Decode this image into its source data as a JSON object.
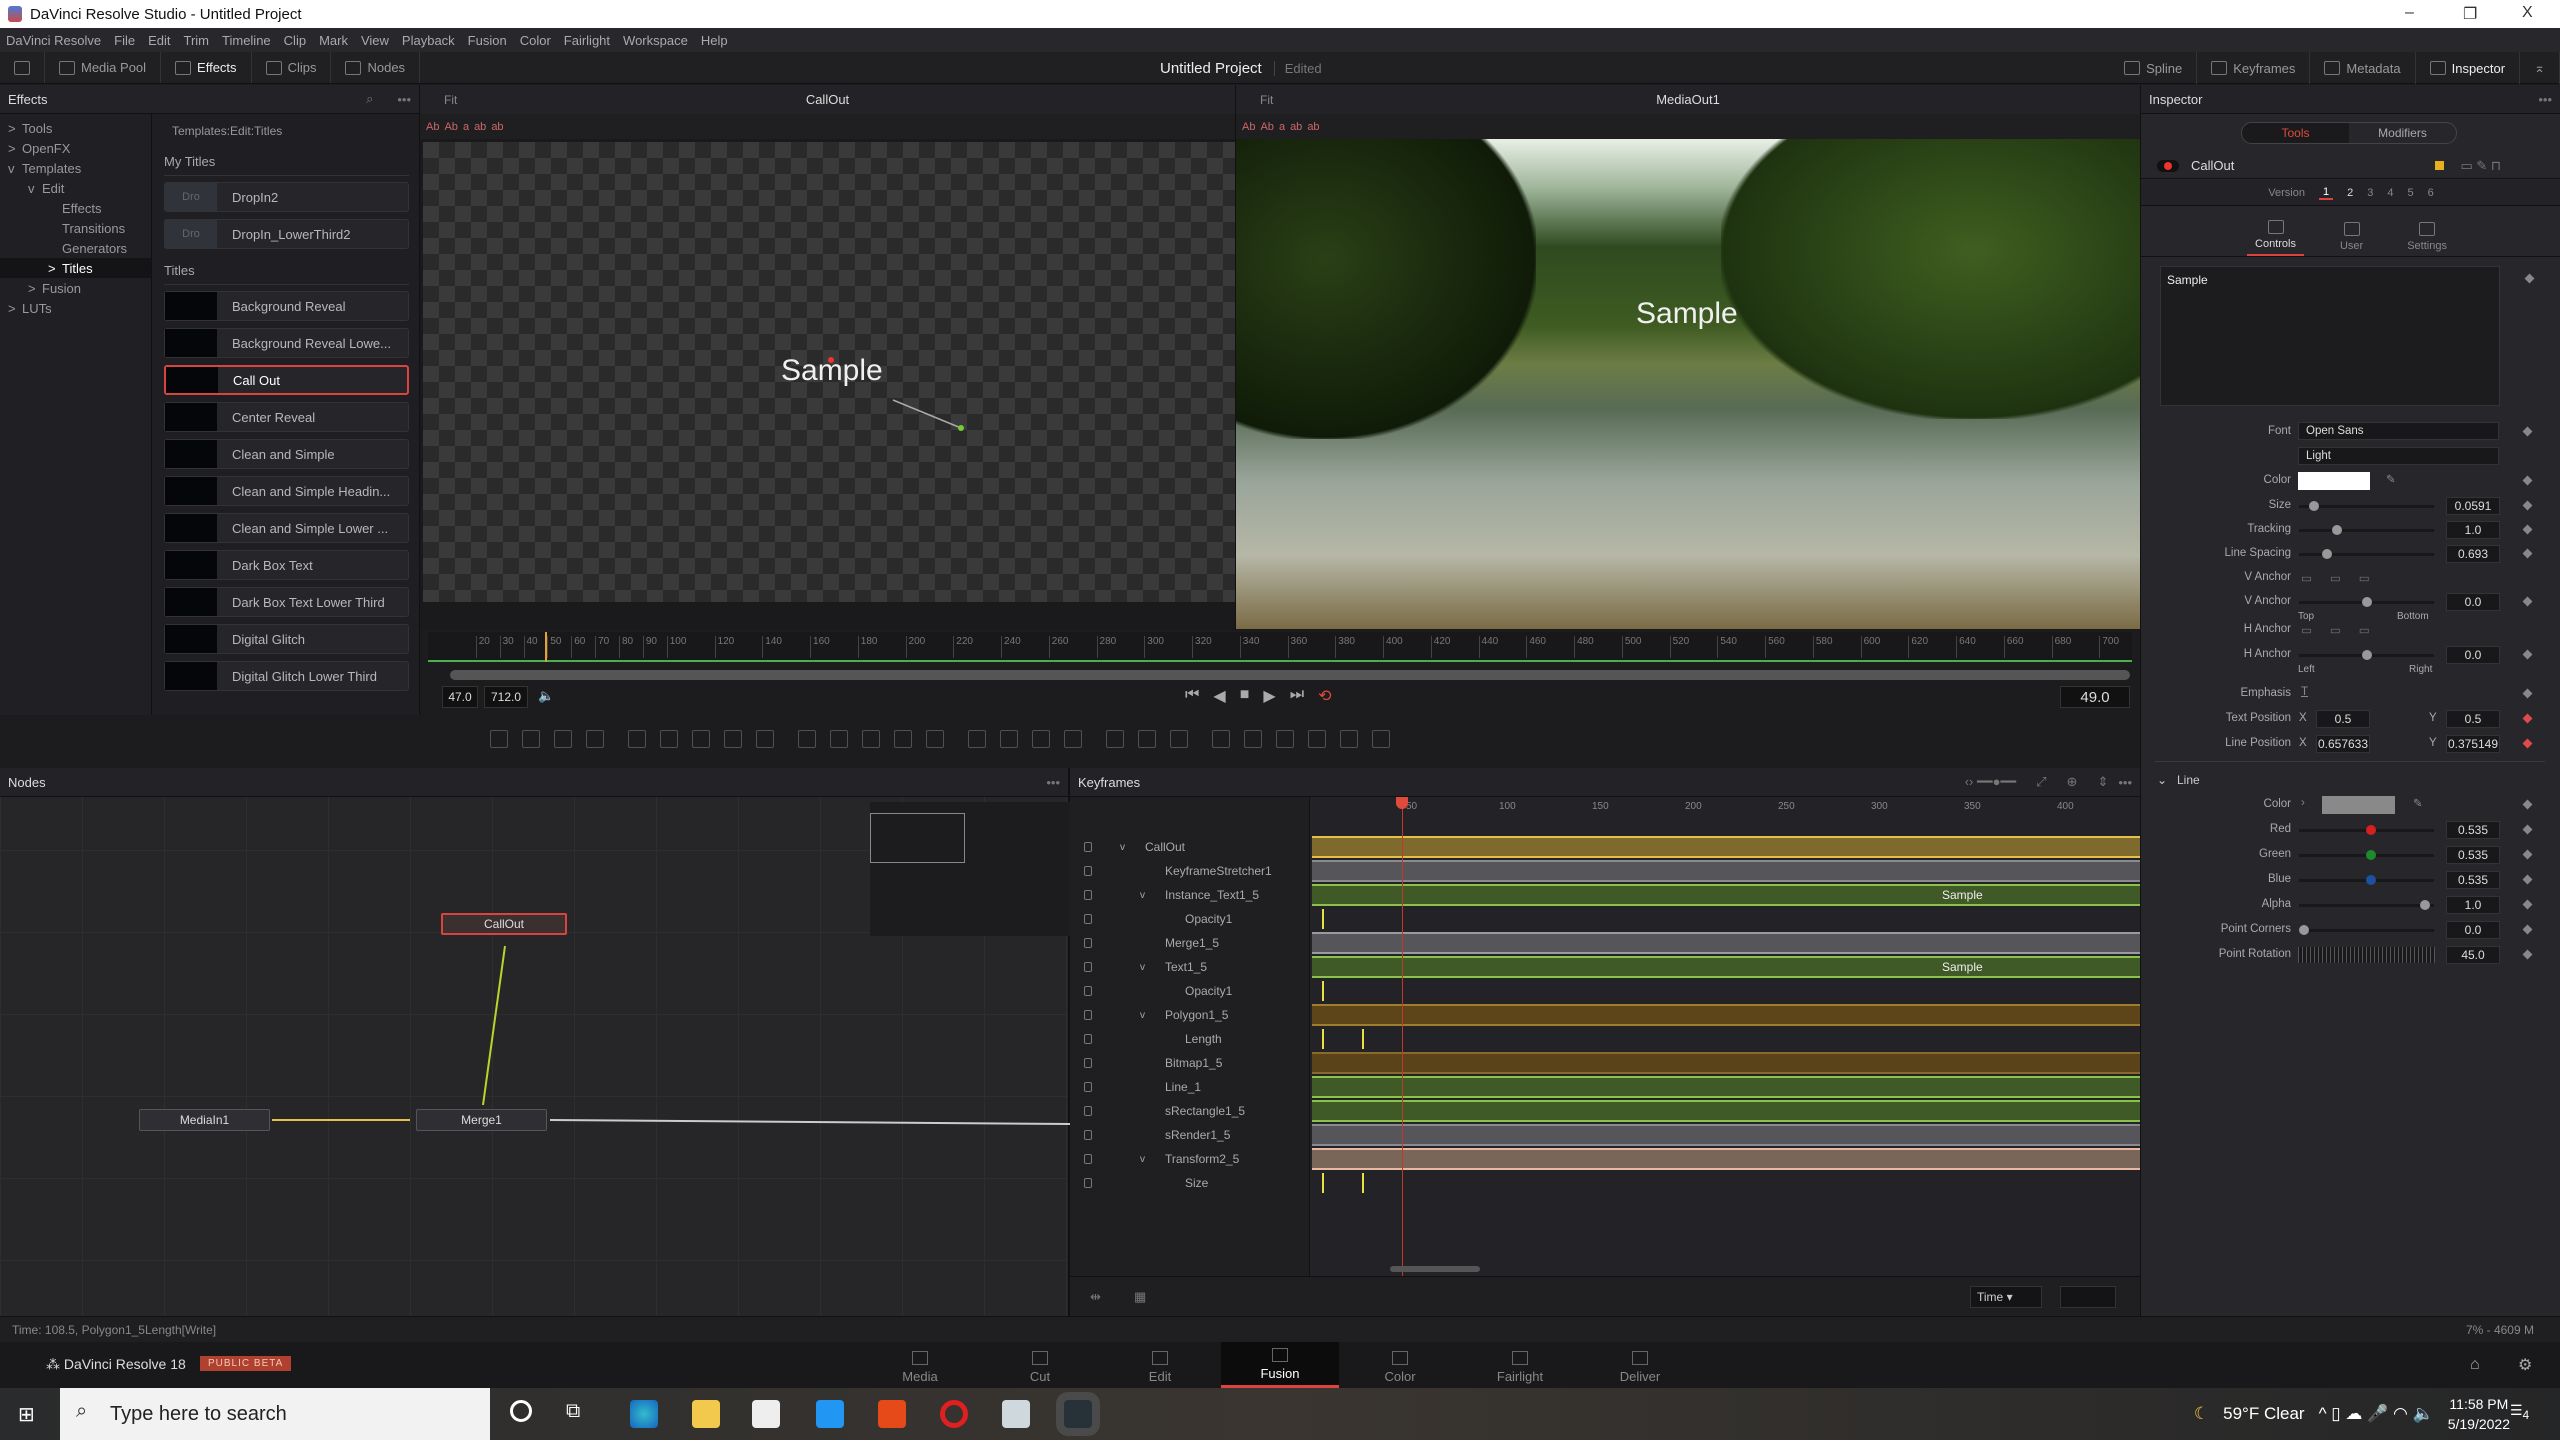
{
  "window": {
    "title": "DaVinci Resolve Studio - Untitled Project",
    "minimize": "–",
    "restore": "❐",
    "close": "X"
  },
  "menu": [
    "DaVinci Resolve",
    "File",
    "Edit",
    "Trim",
    "Timeline",
    "Clip",
    "Mark",
    "View",
    "Playback",
    "Fusion",
    "Color",
    "Fairlight",
    "Workspace",
    "Help"
  ],
  "toolbar": {
    "left": [
      {
        "label": "Media Pool",
        "icon": "media-pool-icon"
      },
      {
        "label": "Effects",
        "icon": "effects-wand-icon",
        "active": true
      },
      {
        "label": "Clips",
        "icon": "clips-icon"
      },
      {
        "label": "Nodes",
        "icon": "nodes-icon"
      }
    ],
    "project": "Untitled Project",
    "edited": "Edited",
    "right": [
      {
        "label": "Spline",
        "icon": "spline-icon"
      },
      {
        "label": "Keyframes",
        "icon": "keyframes-icon"
      },
      {
        "label": "Metadata",
        "icon": "metadata-icon"
      },
      {
        "label": "Inspector",
        "icon": "inspector-icon",
        "active": true
      }
    ]
  },
  "effects": {
    "title": "Effects",
    "tree": [
      {
        "label": "Tools",
        "lvl": 0,
        "arrow": ">"
      },
      {
        "label": "OpenFX",
        "lvl": 0,
        "arrow": ">"
      },
      {
        "label": "Templates",
        "lvl": 0,
        "arrow": "v"
      },
      {
        "label": "Edit",
        "lvl": 1,
        "arrow": "v"
      },
      {
        "label": "Effects",
        "lvl": 2,
        "arrow": ""
      },
      {
        "label": "Transitions",
        "lvl": 2,
        "arrow": ""
      },
      {
        "label": "Generators",
        "lvl": 2,
        "arrow": ""
      },
      {
        "label": "Titles",
        "lvl": 2,
        "arrow": ">",
        "selected": true
      },
      {
        "label": "Fusion",
        "lvl": 1,
        "arrow": ">"
      },
      {
        "label": "LUTs",
        "lvl": 0,
        "arrow": ">"
      }
    ],
    "breadcrumb": "Templates:Edit:Titles",
    "my_titles_header": "My Titles",
    "my_titles": [
      {
        "thumb": "Dro",
        "label": "DropIn2"
      },
      {
        "thumb": "Dro",
        "label": "DropIn_LowerThird2"
      }
    ],
    "titles_header": "Titles",
    "titles": [
      "Background Reveal",
      "Background Reveal Lowe...",
      "Call Out",
      "Center Reveal",
      "Clean and Simple",
      "Clean and Simple Headin...",
      "Clean and Simple Lower ...",
      "Dark Box Text",
      "Dark Box Text Lower Third",
      "Digital Glitch",
      "Digital Glitch Lower Third"
    ],
    "selected_title": "Call Out"
  },
  "viewer_left": {
    "fit": "Fit",
    "title": "CallOut",
    "overlay_text": "Sample"
  },
  "viewer_right": {
    "fit": "Fit",
    "title": "MediaOut1",
    "overlay_text": "Sample"
  },
  "timeline": {
    "ticks": [
      20,
      30,
      40,
      50,
      60,
      70,
      80,
      90,
      100,
      120,
      140,
      160,
      180,
      200,
      220,
      240,
      260,
      280,
      300,
      320,
      340,
      360,
      380,
      400,
      420,
      440,
      460,
      480,
      500,
      520,
      540,
      560,
      580,
      600,
      620,
      640,
      660,
      680,
      700
    ],
    "range": [
      0,
      712
    ],
    "start": "47.0",
    "end": "712.0",
    "current": "49.0",
    "current_frame": 49
  },
  "transport": {
    "first": "⏮",
    "prev": "◀",
    "stop": "■",
    "play": "▶",
    "last": "⏭",
    "loop": "⟲"
  },
  "tools_bar": [
    "background-icon",
    "paint-icon",
    "text-icon",
    "brush-icon",
    "particles-icon",
    "color-corrector-icon",
    "curves-icon",
    "brightness-icon",
    "blur-icon",
    "merge-icon",
    "matte-icon",
    "mediain-icon",
    "resize-icon",
    "transform-icon",
    "rectangle-icon",
    "ellipse-icon",
    "polygon-icon",
    "bspline-icon",
    "tracker-icon",
    "planar-tracker-icon",
    "camera-tracker-icon",
    "shape3d-icon",
    "image-plane-icon",
    "text3d-icon",
    "merge3d-icon",
    "renderer3d-icon",
    "camera3d-icon"
  ],
  "nodes": {
    "title": "Nodes",
    "items": [
      {
        "id": "callout",
        "label": "CallOut"
      },
      {
        "id": "mediain",
        "label": "MediaIn1"
      },
      {
        "id": "merge",
        "label": "Merge1"
      }
    ]
  },
  "keyframes": {
    "title": "Keyframes",
    "ruler": [
      50,
      100,
      150,
      200,
      250,
      300,
      350,
      400
    ],
    "playhead": 49,
    "rows": [
      {
        "label": "CallOut",
        "lvl": 0,
        "arrow": "v",
        "color": "#7d6a2c",
        "edge": "#e5c14a"
      },
      {
        "label": "KeyframeStretcher1",
        "lvl": 1,
        "arrow": "",
        "color": "#56565a",
        "edge": "#8a8a90"
      },
      {
        "label": "Instance_Text1_5",
        "lvl": 1,
        "arrow": "v",
        "color": "#3f5a26",
        "edge": "#8bc34a",
        "text": "Sample"
      },
      {
        "label": "Opacity1",
        "lvl": 2,
        "arrow": "",
        "color": "",
        "edge": ""
      },
      {
        "label": "Merge1_5",
        "lvl": 1,
        "arrow": "",
        "color": "#56565a",
        "edge": "#9a9aa0"
      },
      {
        "label": "Text1_5",
        "lvl": 1,
        "arrow": "v",
        "color": "#3f5a26",
        "edge": "#8bc34a",
        "text": "Sample"
      },
      {
        "label": "Opacity1",
        "lvl": 2,
        "arrow": "",
        "color": "",
        "edge": ""
      },
      {
        "label": "Polygon1_5",
        "lvl": 1,
        "arrow": "v",
        "color": "#5e4519",
        "edge": "#a07d2c"
      },
      {
        "label": "Length",
        "lvl": 2,
        "arrow": "",
        "color": "",
        "edge": ""
      },
      {
        "label": "Bitmap1_5",
        "lvl": 1,
        "arrow": "",
        "color": "#5a4219",
        "edge": "#8a6a2c"
      },
      {
        "label": "Line_1",
        "lvl": 1,
        "arrow": "",
        "color": "#3f5a26",
        "edge": "#8bc34a"
      },
      {
        "label": "sRectangle1_5",
        "lvl": 1,
        "arrow": "",
        "color": "#3f5a26",
        "edge": "#8bc34a"
      },
      {
        "label": "sRender1_5",
        "lvl": 1,
        "arrow": "",
        "color": "#56565a",
        "edge": "#8a8a90"
      },
      {
        "label": "Transform2_5",
        "lvl": 1,
        "arrow": "v",
        "color": "#7a6658",
        "edge": "#e8b8a0"
      },
      {
        "label": "Size",
        "lvl": 2,
        "arrow": "",
        "color": "",
        "edge": ""
      }
    ],
    "time_mode": "Time"
  },
  "inspector": {
    "title": "Inspector",
    "tabs": [
      "Tools",
      "Modifiers"
    ],
    "active_tab": "Tools",
    "node_name": "CallOut",
    "node_color": "#e8b020",
    "version_label": "Version",
    "versions": [
      "1",
      "2",
      "3",
      "4",
      "5",
      "6"
    ],
    "active_version": "1",
    "subtabs": [
      "Controls",
      "User",
      "Settings"
    ],
    "active_subtab": "Controls",
    "text_value": "Sample",
    "font_label": "Font",
    "font": "Open Sans",
    "style": "Light",
    "color_label": "Color",
    "text_color": "#ffffff",
    "sliders": [
      {
        "label": "Size",
        "value": "0.0591",
        "pos": 0.08
      },
      {
        "label": "Tracking",
        "value": "1.0",
        "pos": 0.26
      },
      {
        "label": "Line Spacing",
        "value": "0.693",
        "pos": 0.18
      }
    ],
    "v_anchor_label": "V Anchor",
    "v_anchor": {
      "label": "V Anchor",
      "value": "0.0",
      "pos": 0.5,
      "min": "Top",
      "max": "Bottom"
    },
    "h_anchor_label": "H Anchor",
    "h_anchor": {
      "label": "H Anchor",
      "value": "0.0",
      "pos": 0.5,
      "min": "Left",
      "max": "Right"
    },
    "emphasis_label": "Emphasis",
    "emphasis_icon": "T",
    "text_position": {
      "label": "Text Position",
      "x_label": "X",
      "x": "0.5",
      "y_label": "Y",
      "y": "0.5"
    },
    "line_position": {
      "label": "Line Position",
      "x_label": "X",
      "x": "0.657633",
      "y_label": "Y",
      "y": "0.375149"
    },
    "line_section": "Line",
    "line_color_label": "Color",
    "line_color": "#898989",
    "line_sliders": [
      {
        "label": "Red",
        "value": "0.535",
        "pos": 0.535,
        "color": "#d62020"
      },
      {
        "label": "Green",
        "value": "0.535",
        "pos": 0.535,
        "color": "#1e8a2e"
      },
      {
        "label": "Blue",
        "value": "0.535",
        "pos": 0.535,
        "color": "#1f4fa0"
      },
      {
        "label": "Alpha",
        "value": "1.0",
        "pos": 0.97,
        "color": "#999999"
      },
      {
        "label": "Point Corners",
        "value": "0.0",
        "pos": 0.0,
        "color": "#999999"
      }
    ],
    "point_rotation": {
      "label": "Point Rotation",
      "value": "45.0"
    }
  },
  "status": {
    "left": "Time: 108.5,     Polygon1_5Length[Write]",
    "right": "7% - 4609 M"
  },
  "pagebar": {
    "app": "DaVinci Resolve 18",
    "badge": "PUBLIC BETA",
    "pages": [
      "Media",
      "Cut",
      "Edit",
      "Fusion",
      "Color",
      "Fairlight",
      "Deliver"
    ],
    "active": "Fusion"
  },
  "taskbar": {
    "search_placeholder": "Type here to search",
    "weather": "59°F  Clear",
    "time": "11:58 PM",
    "date": "5/19/2022",
    "notifications": "4"
  }
}
